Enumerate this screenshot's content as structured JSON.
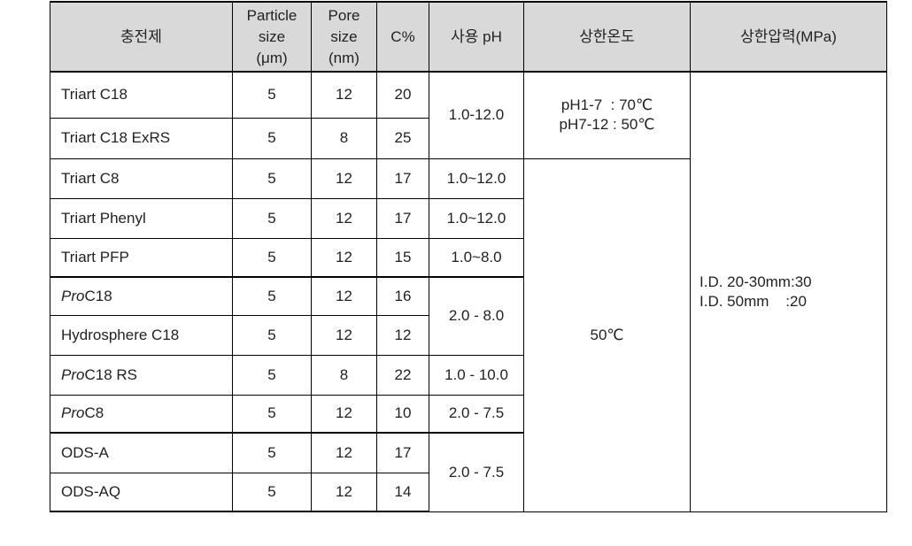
{
  "headers": {
    "packing": "충전제",
    "particle": [
      "Particle",
      "size",
      "(μm)"
    ],
    "pore": [
      "Pore",
      "size",
      "(nm)"
    ],
    "carbon": "C%",
    "ph": "사용 pH",
    "temp": "상한온도",
    "pressure": "상한압력(MPa)"
  },
  "rows": [
    {
      "prefix": "",
      "name": "Triart C18",
      "particle": "5",
      "pore": "12",
      "carbon": "20"
    },
    {
      "prefix": "",
      "name": "Triart C18 ExRS",
      "particle": "5",
      "pore": "8",
      "carbon": "25"
    },
    {
      "prefix": "",
      "name": "Triart C8",
      "particle": "5",
      "pore": "12",
      "carbon": "17"
    },
    {
      "prefix": "",
      "name": "Triart Phenyl",
      "particle": "5",
      "pore": "12",
      "carbon": "17"
    },
    {
      "prefix": "",
      "name": "Triart PFP",
      "particle": "5",
      "pore": "12",
      "carbon": "15"
    },
    {
      "prefix": "Pro",
      "name": "C18",
      "particle": "5",
      "pore": "12",
      "carbon": "16"
    },
    {
      "prefix": "",
      "name": "Hydrosphere C18",
      "particle": "5",
      "pore": "12",
      "carbon": "12"
    },
    {
      "prefix": "Pro",
      "name": "C18 RS",
      "particle": "5",
      "pore": "8",
      "carbon": "22"
    },
    {
      "prefix": "Pro",
      "name": "C8",
      "particle": "5",
      "pore": "12",
      "carbon": "10"
    },
    {
      "prefix": "",
      "name": "ODS-A",
      "particle": "5",
      "pore": "12",
      "carbon": "17"
    },
    {
      "prefix": "",
      "name": "ODS-AQ",
      "particle": "5",
      "pore": "12",
      "carbon": "14"
    }
  ],
  "ph_ranges": [
    "1.0-12.0",
    "1.0~12.0",
    "1.0~12.0",
    "1.0~8.0",
    "2.0 - 8.0",
    "1.0 - 10.0",
    "2.0 - 7.5",
    "2.0 - 7.5"
  ],
  "temperature": {
    "triart_c18_line1": "pH1-7  : 70℃",
    "triart_c18_line2": "pH7-12 : 50℃",
    "others": "50℃"
  },
  "pressure": {
    "line1": "I.D. 20-30mm:30",
    "line2": "I.D. 50mm    :20"
  }
}
